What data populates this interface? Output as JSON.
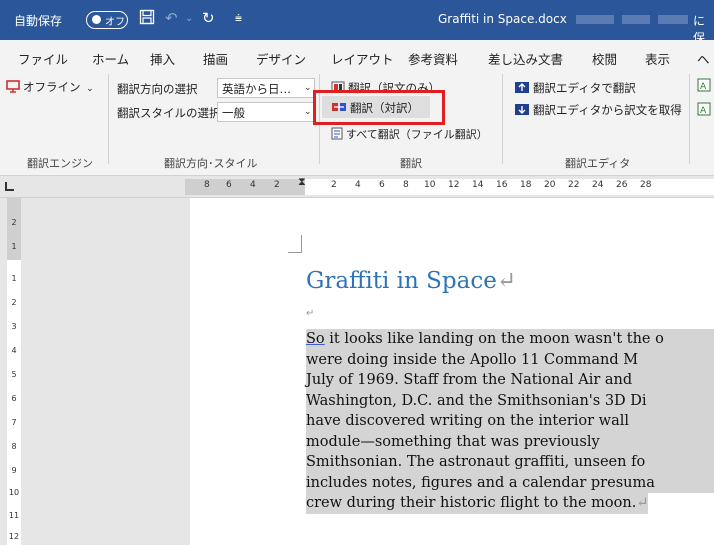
{
  "titlebar": {
    "autosave_label": "自動保存",
    "autosave_state": "オフ",
    "doc_title": "Graffiti in Space.docx",
    "save_fragment": "に保"
  },
  "tabs": [
    "ファイル",
    "ホーム",
    "挿入",
    "描画",
    "デザイン",
    "レイアウト",
    "参考資料",
    "差し込み文書",
    "校閲",
    "表示",
    "ヘ"
  ],
  "ribbon": {
    "offline_label": "オフライン",
    "engine_group": "翻訳エンジン",
    "direction_label": "翻訳方向の選択",
    "direction_value": "英語から日…",
    "style_label": "翻訳スタイルの選択",
    "style_value": "一般",
    "direction_group": "翻訳方向･スタイル",
    "translate_single": "翻訳（訳文のみ）",
    "translate_parallel": "翻訳（対訳）",
    "translate_all": "すべて翻訳（ファイル翻訳）",
    "translate_group": "翻訳",
    "editor_translate": "翻訳エディタで翻訳",
    "editor_get": "翻訳エディタから訳文を取得",
    "editor_group": "翻訳エディタ"
  },
  "ruler": {
    "left_numbers": [
      "8",
      "6",
      "4",
      "2"
    ],
    "right_numbers": [
      "2",
      "4",
      "6",
      "8",
      "10",
      "12",
      "14",
      "16",
      "18",
      "20",
      "22",
      "24",
      "26",
      "28"
    ]
  },
  "vruler": {
    "top_numbers": [
      "2",
      "1"
    ],
    "numbers": [
      "1",
      "2",
      "3",
      "4",
      "5",
      "6",
      "7",
      "8",
      "9",
      "10",
      "11",
      "12"
    ]
  },
  "document": {
    "heading": "Graffiti in Space",
    "first_word": "So",
    "lines": [
      " it looks like landing on the moon wasn't the o",
      "were doing inside the Apollo 11 Command M",
      "July of 1969. Staff from the National Air and",
      "Washington, D.C. and the Smithsonian's 3D Di",
      "have discovered writing on the interior wall",
      "module—something that was previously",
      "Smithsonian. The astronaut graffiti, unseen fo",
      "includes notes, figures and a calendar presuma",
      "crew during their historic flight to the moon."
    ]
  },
  "colors": {
    "titlebar_bg": "#2b579a",
    "highlight_box": "#e02020",
    "heading_color": "#2e74b5",
    "selection_bg": "#d4d4d4"
  }
}
